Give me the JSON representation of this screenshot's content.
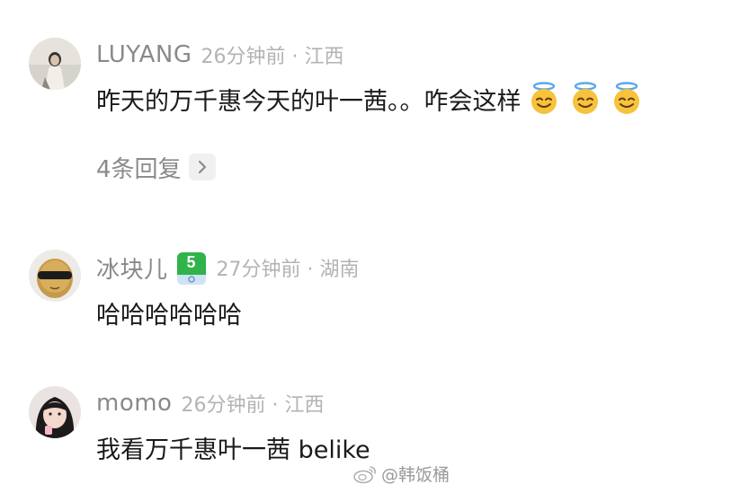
{
  "comments": [
    {
      "username": "LUYANG",
      "time_location": "26分钟前 · 江西",
      "text": "昨天的万千惠今天的叶一茜。。咋会这样",
      "emojis": [
        "smiling-halo-emoji",
        "smiling-halo-emoji",
        "smiling-halo-emoji"
      ],
      "replies_label": "4条回复"
    },
    {
      "username": "冰块儿",
      "level": "5",
      "time_location": "27分钟前 · 湖南",
      "text": "哈哈哈哈哈哈"
    },
    {
      "username": "momo",
      "time_location": "26分钟前 · 江西",
      "text": "我看万千惠叶一茜 belike"
    }
  ],
  "watermark": "@韩饭桶",
  "colors": {
    "username": "#8a8a8a",
    "meta": "#b3b3b3",
    "body_text": "#1a1a1a",
    "badge_green": "#2fb34a"
  }
}
